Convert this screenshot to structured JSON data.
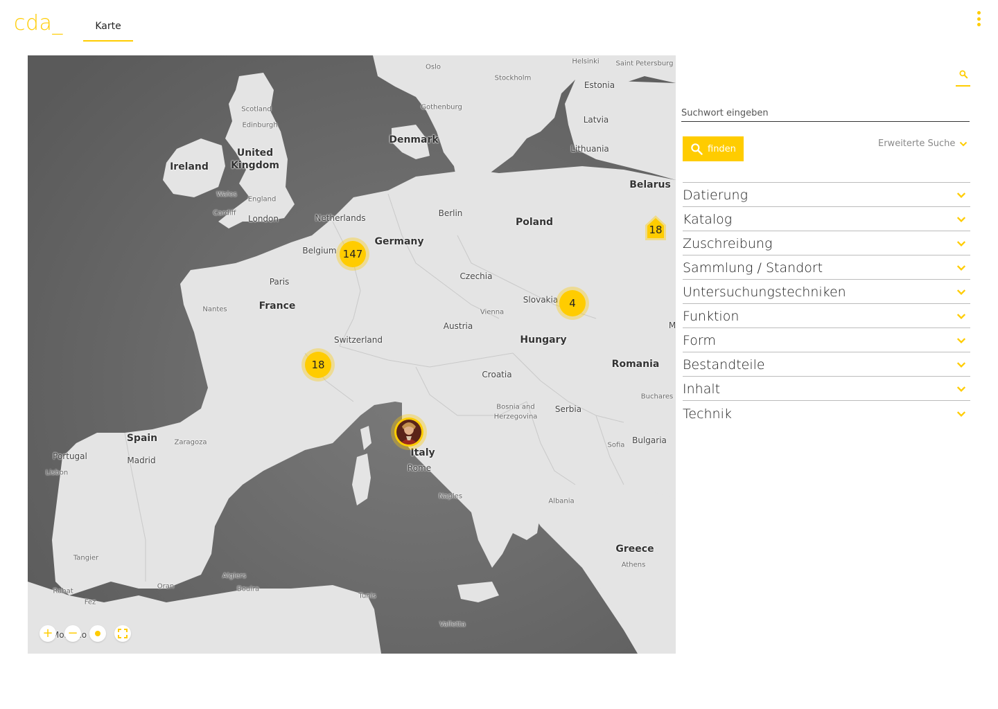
{
  "header": {
    "logo": "cda_",
    "nav_tab": "Karte",
    "menu_icon": "more-vert-icon"
  },
  "map": {
    "labels": [
      {
        "id": "oslo",
        "text": "Oslo"
      },
      {
        "id": "stockholm",
        "text": "Stockholm"
      },
      {
        "id": "helsinki",
        "text": "Helsinki"
      },
      {
        "id": "stpetersburg",
        "text": "Saint\nPetersburg"
      },
      {
        "id": "estonia",
        "text": "Estonia"
      },
      {
        "id": "gothenburg",
        "text": "Gothenburg"
      },
      {
        "id": "latvia",
        "text": "Latvia"
      },
      {
        "id": "scotland",
        "text": "Scotland"
      },
      {
        "id": "edinburgh",
        "text": "Edinburgh"
      },
      {
        "id": "denmark",
        "text": "Denmark"
      },
      {
        "id": "lithuania",
        "text": "Lithuania"
      },
      {
        "id": "united",
        "text": "United"
      },
      {
        "id": "kingdom",
        "text": "Kingdom"
      },
      {
        "id": "ireland",
        "text": "Ireland"
      },
      {
        "id": "belarus",
        "text": "Belarus"
      },
      {
        "id": "wales",
        "text": "Wales"
      },
      {
        "id": "england",
        "text": "England"
      },
      {
        "id": "cardiff",
        "text": "Cardiff"
      },
      {
        "id": "london",
        "text": "London"
      },
      {
        "id": "netherlands",
        "text": "Netherlands"
      },
      {
        "id": "berlin",
        "text": "Berlin"
      },
      {
        "id": "poland",
        "text": "Poland"
      },
      {
        "id": "belgium",
        "text": "Belgium"
      },
      {
        "id": "germany",
        "text": "Germany"
      },
      {
        "id": "paris",
        "text": "Paris"
      },
      {
        "id": "czechia",
        "text": "Czechia"
      },
      {
        "id": "france",
        "text": "France"
      },
      {
        "id": "nantes",
        "text": "Nantes"
      },
      {
        "id": "slovakia",
        "text": "Slovakia"
      },
      {
        "id": "vienna",
        "text": "Vienna"
      },
      {
        "id": "austria",
        "text": "Austria"
      },
      {
        "id": "switzerland",
        "text": "Switzerland"
      },
      {
        "id": "hungary",
        "text": "Hungary"
      },
      {
        "id": "romania",
        "text": "Romania"
      },
      {
        "id": "croatia",
        "text": "Croatia"
      },
      {
        "id": "bucharest",
        "text": "Buchares"
      },
      {
        "id": "bosnia1",
        "text": "Bosnia and"
      },
      {
        "id": "bosnia2",
        "text": "Herzegovina"
      },
      {
        "id": "serbia",
        "text": "Serbia"
      },
      {
        "id": "spain",
        "text": "Spain"
      },
      {
        "id": "zaragoza",
        "text": "Zaragoza"
      },
      {
        "id": "sofia",
        "text": "Sofia"
      },
      {
        "id": "bulgaria",
        "text": "Bulgaria"
      },
      {
        "id": "italy",
        "text": "Italy"
      },
      {
        "id": "portugal",
        "text": "Portugal"
      },
      {
        "id": "madrid",
        "text": "Madrid"
      },
      {
        "id": "rome",
        "text": "Rome"
      },
      {
        "id": "lisbon",
        "text": "Lisbon"
      },
      {
        "id": "naples",
        "text": "Naples"
      },
      {
        "id": "albania",
        "text": "Albania"
      },
      {
        "id": "greece",
        "text": "Greece"
      },
      {
        "id": "athens",
        "text": "Athens"
      },
      {
        "id": "tangier",
        "text": "Tangier"
      },
      {
        "id": "algiers",
        "text": "Algiers"
      },
      {
        "id": "oran",
        "text": "Oran"
      },
      {
        "id": "bouira",
        "text": "Bouira"
      },
      {
        "id": "tunis",
        "text": "Tunis"
      },
      {
        "id": "rabat",
        "text": "Rabat"
      },
      {
        "id": "fez",
        "text": "Fez"
      },
      {
        "id": "valletta",
        "text": "Valletta"
      },
      {
        "id": "morocco",
        "text": "Morocco"
      },
      {
        "id": "m_edge",
        "text": "M"
      }
    ],
    "clusters": [
      {
        "id": "c147",
        "count": "147"
      },
      {
        "id": "c4",
        "count": "4"
      },
      {
        "id": "c18",
        "count": "18"
      }
    ],
    "edge_cluster": {
      "count": "18"
    },
    "photo_marker_icon": "portrait-thumbnail",
    "controls": {
      "zoom_in": "+",
      "zoom_out": "−",
      "locate_icon": "locate-dot-icon",
      "fullscreen_icon": "fullscreen-icon"
    },
    "colors": {
      "land": "#e6e6e6",
      "water": "#6d6d6d",
      "accent": "#ffcc00"
    }
  },
  "panel": {
    "search_toggle_icon": "search-icon",
    "search_placeholder": "Suchwort eingeben",
    "find_button": "finden",
    "advanced_search": "Erweiterte Suche",
    "facets": [
      "Datierung",
      "Katalog",
      "Zuschreibung",
      "Sammlung / Standort",
      "Untersuchungstechniken",
      "Funktion",
      "Form",
      "Bestandteile",
      "Inhalt",
      "Technik"
    ]
  }
}
